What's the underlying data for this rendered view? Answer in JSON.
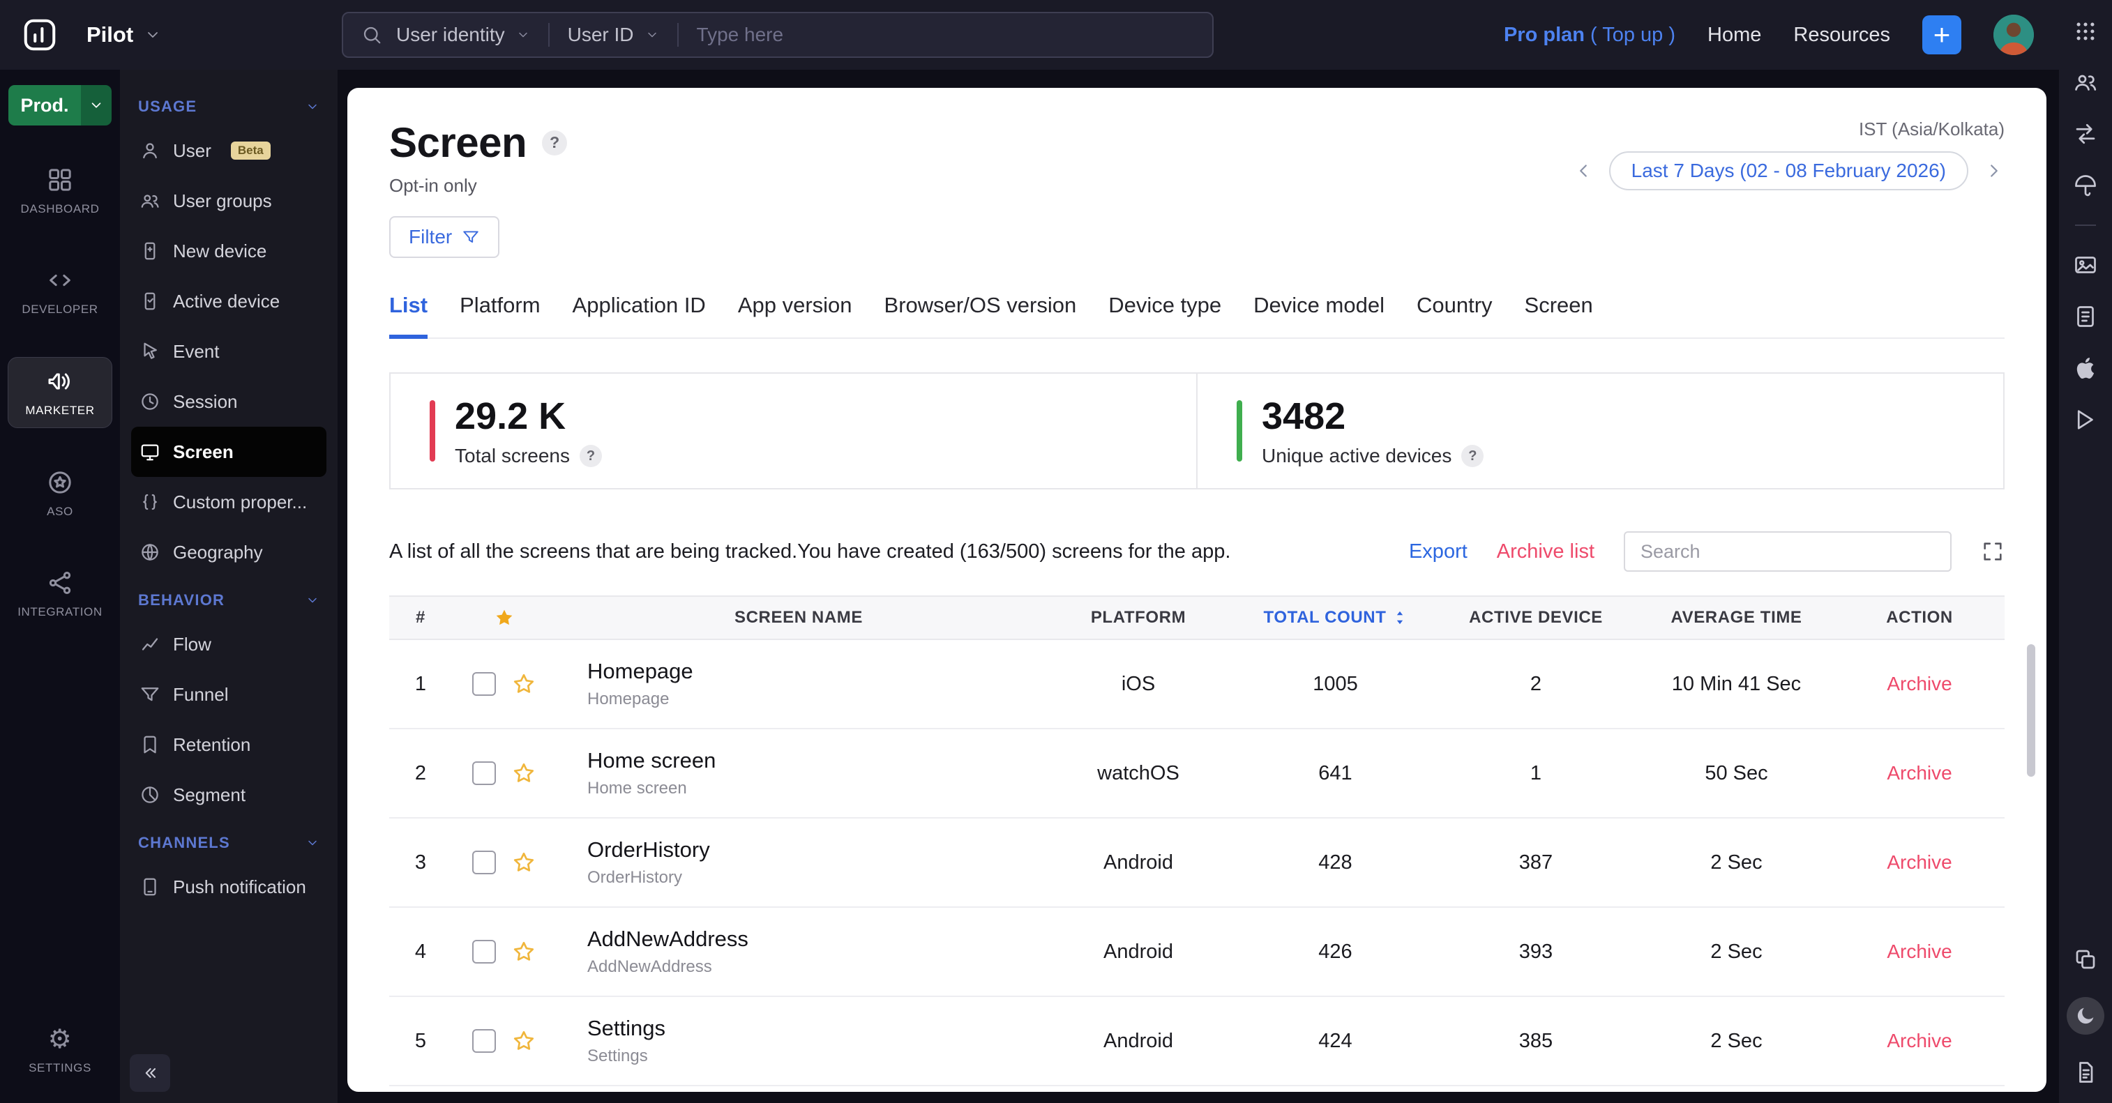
{
  "topbar": {
    "product": "Pilot",
    "search_category": "User identity",
    "search_field": "User ID",
    "search_placeholder": "Type here",
    "pro_plan": "Pro plan",
    "top_up": "( Top up )",
    "home": "Home",
    "resources": "Resources",
    "add_label": "+"
  },
  "rail": {
    "env": "Prod.",
    "dashboard": "DASHBOARD",
    "developer": "DEVELOPER",
    "marketer": "MARKETER",
    "aso": "ASO",
    "integration": "INTEGRATION",
    "settings": "SETTINGS",
    "gear_glyph": "⚙"
  },
  "menu": {
    "usage_title": "USAGE",
    "user": "User",
    "user_beta": "Beta",
    "user_groups": "User groups",
    "new_device": "New device",
    "active_device": "Active device",
    "event": "Event",
    "session": "Session",
    "screen": "Screen",
    "custom_properties": "Custom proper...",
    "geography": "Geography",
    "behavior_title": "BEHAVIOR",
    "flow": "Flow",
    "funnel": "Funnel",
    "retention": "Retention",
    "segment": "Segment",
    "channels_title": "CHANNELS",
    "push_notification": "Push notification"
  },
  "header": {
    "title": "Screen",
    "help": "?",
    "subtitle": "Opt-in only",
    "timezone": "IST (Asia/Kolkata)",
    "date_range": "Last 7 Days (02 - 08 February 2026)",
    "filter": "Filter"
  },
  "tabs": [
    "List",
    "Platform",
    "Application ID",
    "App version",
    "Browser/OS version",
    "Device type",
    "Device model",
    "Country",
    "Screen"
  ],
  "stats": {
    "total_screens": {
      "value": "29.2 K",
      "label": "Total screens",
      "accent": "#e23b53"
    },
    "unique_devices": {
      "value": "3482",
      "label": "Unique active devices",
      "accent": "#3fae4e"
    }
  },
  "listing": {
    "description": "A list of all the screens that are being tracked.You have created (163/500) screens for the app.",
    "export": "Export",
    "archive_list": "Archive list",
    "search_placeholder": "Search"
  },
  "table": {
    "headers": {
      "index": "#",
      "name": "SCREEN NAME",
      "platform": "PLATFORM",
      "total": "TOTAL COUNT",
      "active": "ACTIVE DEVICE",
      "avg": "AVERAGE TIME",
      "action": "ACTION"
    },
    "rows": [
      {
        "index": "1",
        "name": "Homepage",
        "subname": "Homepage",
        "platform": "iOS",
        "total": "1005",
        "active": "2",
        "avg": "10 Min 41 Sec",
        "action": "Archive"
      },
      {
        "index": "2",
        "name": "Home screen",
        "subname": "Home screen",
        "platform": "watchOS",
        "total": "641",
        "active": "1",
        "avg": "50 Sec",
        "action": "Archive"
      },
      {
        "index": "3",
        "name": "OrderHistory",
        "subname": "OrderHistory",
        "platform": "Android",
        "total": "428",
        "active": "387",
        "avg": "2 Sec",
        "action": "Archive"
      },
      {
        "index": "4",
        "name": "AddNewAddress",
        "subname": "AddNewAddress",
        "platform": "Android",
        "total": "426",
        "active": "393",
        "avg": "2 Sec",
        "action": "Archive"
      },
      {
        "index": "5",
        "name": "Settings",
        "subname": "Settings",
        "platform": "Android",
        "total": "424",
        "active": "385",
        "avg": "2 Sec",
        "action": "Archive"
      }
    ]
  },
  "colors": {
    "accent_blue": "#2f63dd",
    "link_blue": "#2b66e0",
    "danger_red": "#ee4a6b",
    "stat_red": "#e23b53",
    "stat_green": "#3fae4e",
    "env_green": "#1e7c4a",
    "topbar_bg": "#1a1a26",
    "card_bg": "#ffffff"
  }
}
